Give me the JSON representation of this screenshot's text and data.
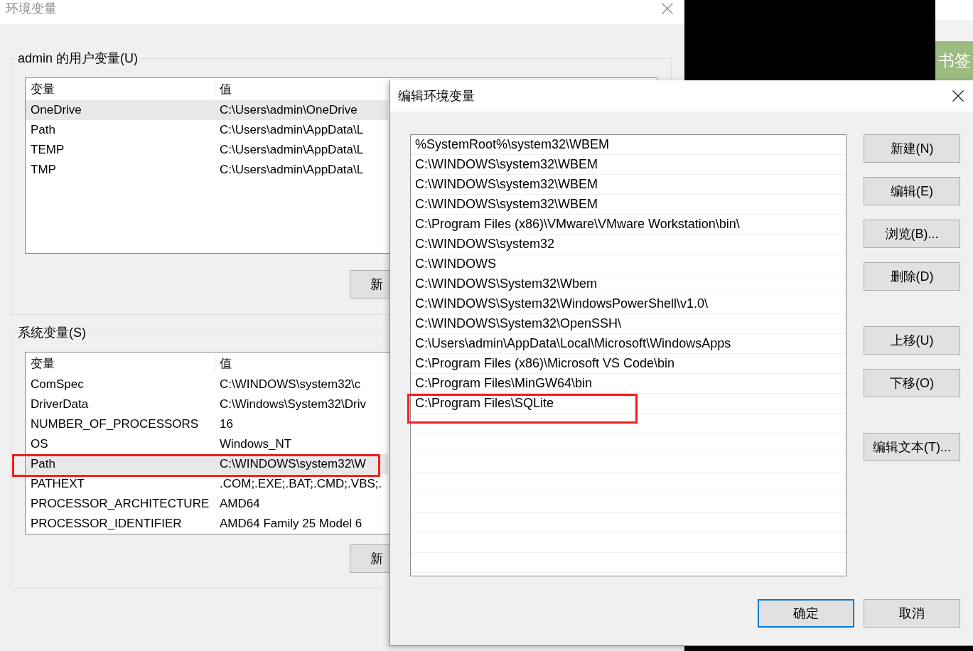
{
  "background_window": {
    "title": "环境变量",
    "user_variables": {
      "label": "admin 的用户变量(U)",
      "columns": [
        "变量",
        "值"
      ],
      "rows": [
        {
          "name": "OneDrive",
          "value": "C:\\Users\\admin\\OneDrive",
          "selected": true
        },
        {
          "name": "Path",
          "value": "C:\\Users\\admin\\AppData\\L",
          "selected": false
        },
        {
          "name": "TEMP",
          "value": "C:\\Users\\admin\\AppData\\L",
          "selected": false
        },
        {
          "name": "TMP",
          "value": "C:\\Users\\admin\\AppData\\L",
          "selected": false
        }
      ],
      "buttons": [
        "新"
      ]
    },
    "system_variables": {
      "label": "系统变量(S)",
      "columns": [
        "变量",
        "值"
      ],
      "rows": [
        {
          "name": "ComSpec",
          "value": "C:\\WINDOWS\\system32\\c",
          "selected": false,
          "annotated": false
        },
        {
          "name": "DriverData",
          "value": "C:\\Windows\\System32\\Driv",
          "selected": false,
          "annotated": false
        },
        {
          "name": "NUMBER_OF_PROCESSORS",
          "value": "16",
          "selected": false,
          "annotated": false
        },
        {
          "name": "OS",
          "value": "Windows_NT",
          "selected": false,
          "annotated": false
        },
        {
          "name": "Path",
          "value": "C:\\WINDOWS\\system32\\W",
          "selected": true,
          "annotated": true
        },
        {
          "name": "PATHEXT",
          "value": ".COM;.EXE;.BAT;.CMD;.VBS;.",
          "selected": false,
          "annotated": false
        },
        {
          "name": "PROCESSOR_ARCHITECTURE",
          "value": "AMD64",
          "selected": false,
          "annotated": false
        },
        {
          "name": "PROCESSOR_IDENTIFIER",
          "value": "AMD64 Family 25 Model 6",
          "selected": false,
          "annotated": false
        }
      ],
      "buttons": [
        "新"
      ]
    }
  },
  "side_panel": {
    "tab_label": "书签"
  },
  "edit_dialog": {
    "title": "编辑环境变量",
    "entries": [
      {
        "text": "%SystemRoot%\\system32\\WBEM",
        "selected": false,
        "annotated": false
      },
      {
        "text": "C:\\WINDOWS\\system32\\WBEM",
        "selected": false,
        "annotated": false
      },
      {
        "text": "C:\\WINDOWS\\system32\\WBEM",
        "selected": false,
        "annotated": false
      },
      {
        "text": "C:\\WINDOWS\\system32\\WBEM",
        "selected": false,
        "annotated": false
      },
      {
        "text": "C:\\Program Files (x86)\\VMware\\VMware Workstation\\bin\\",
        "selected": false,
        "annotated": false
      },
      {
        "text": "C:\\WINDOWS\\system32",
        "selected": false,
        "annotated": false
      },
      {
        "text": "C:\\WINDOWS",
        "selected": false,
        "annotated": false
      },
      {
        "text": "C:\\WINDOWS\\System32\\Wbem",
        "selected": false,
        "annotated": false
      },
      {
        "text": "C:\\WINDOWS\\System32\\WindowsPowerShell\\v1.0\\",
        "selected": false,
        "annotated": false
      },
      {
        "text": "C:\\WINDOWS\\System32\\OpenSSH\\",
        "selected": false,
        "annotated": false
      },
      {
        "text": "C:\\Users\\admin\\AppData\\Local\\Microsoft\\WindowsApps",
        "selected": false,
        "annotated": false
      },
      {
        "text": "C:\\Program Files (x86)\\Microsoft VS Code\\bin",
        "selected": false,
        "annotated": false
      },
      {
        "text": "C:\\Program Files\\MinGW64\\bin",
        "selected": false,
        "annotated": false
      },
      {
        "text": "C:\\Program Files\\SQLite",
        "selected": false,
        "annotated": true
      }
    ],
    "button_groups": [
      [
        "新建(N)",
        "编辑(E)",
        "浏览(B)...",
        "删除(D)"
      ],
      [
        "上移(U)",
        "下移(O)"
      ],
      [
        "编辑文本(T)..."
      ]
    ],
    "footer_buttons": [
      {
        "label": "确定",
        "default": true
      },
      {
        "label": "取消",
        "default": false
      }
    ]
  }
}
